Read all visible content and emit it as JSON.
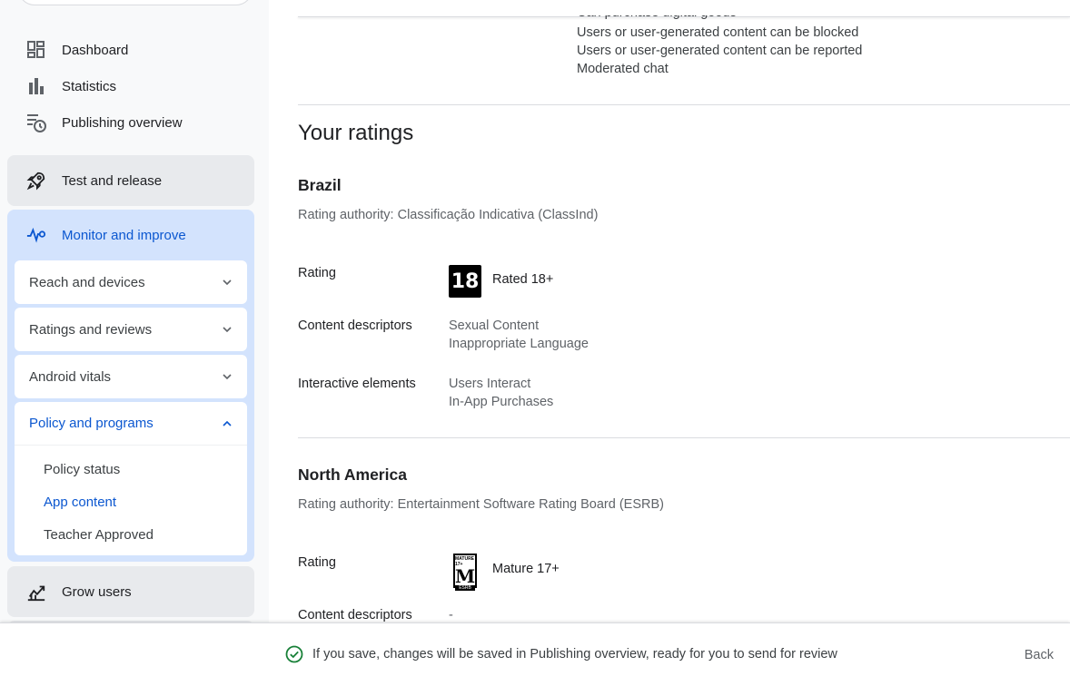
{
  "sidebar": {
    "nav": [
      {
        "label": "Dashboard",
        "icon": "dashboard-icon"
      },
      {
        "label": "Statistics",
        "icon": "bar-chart-icon"
      },
      {
        "label": "Publishing overview",
        "icon": "schedule-list-icon"
      }
    ],
    "sections": {
      "test_release": {
        "label": "Test and release",
        "icon": "rocket-icon"
      },
      "monitor": {
        "label": "Monitor and improve",
        "icon": "pulse-icon",
        "cards": [
          {
            "label": "Reach and devices"
          },
          {
            "label": "Ratings and reviews"
          },
          {
            "label": "Android vitals"
          },
          {
            "label": "Policy and programs",
            "expanded": true
          }
        ],
        "policy_items": [
          "Policy status",
          "App content",
          "Teacher Approved"
        ],
        "selected_item": "App content"
      },
      "grow": {
        "label": "Grow users",
        "icon": "growth-chart-icon"
      }
    }
  },
  "main": {
    "features": [
      "Can purchase digital goods",
      "Users or user-generated content can be blocked",
      "Users or user-generated content can be reported",
      "Moderated chat"
    ],
    "heading": "Your ratings",
    "regions": [
      {
        "name": "Brazil",
        "authority": "Rating authority: Classificação Indicativa (ClassInd)",
        "rating_label": "Rating",
        "badge": "18",
        "rating_text": "Rated 18+",
        "descriptors_label": "Content descriptors",
        "descriptors": [
          "Sexual Content",
          "Inappropriate Language"
        ],
        "interactive_label": "Interactive elements",
        "interactive": [
          "Users Interact",
          "In-App Purchases"
        ]
      },
      {
        "name": "North America",
        "authority": "Rating authority: Entertainment Software Rating Board (ESRB)",
        "rating_label": "Rating",
        "badge_top": "MATURE 17+",
        "badge": "M",
        "badge_bottom": "ESRB",
        "rating_text": "Mature 17+",
        "descriptors_label": "Content descriptors",
        "descriptors": [
          "-"
        ]
      }
    ]
  },
  "footer": {
    "message": "If you save, changes will be saved in Publishing overview, ready for you to send for review",
    "back_label": "Back",
    "status_icon": "check-circle-icon",
    "accent_color": "#188038"
  },
  "colors": {
    "accent_blue": "#0b57d0",
    "active_section_bg": "#d3e3fd",
    "section_bg": "#e8eaed"
  }
}
